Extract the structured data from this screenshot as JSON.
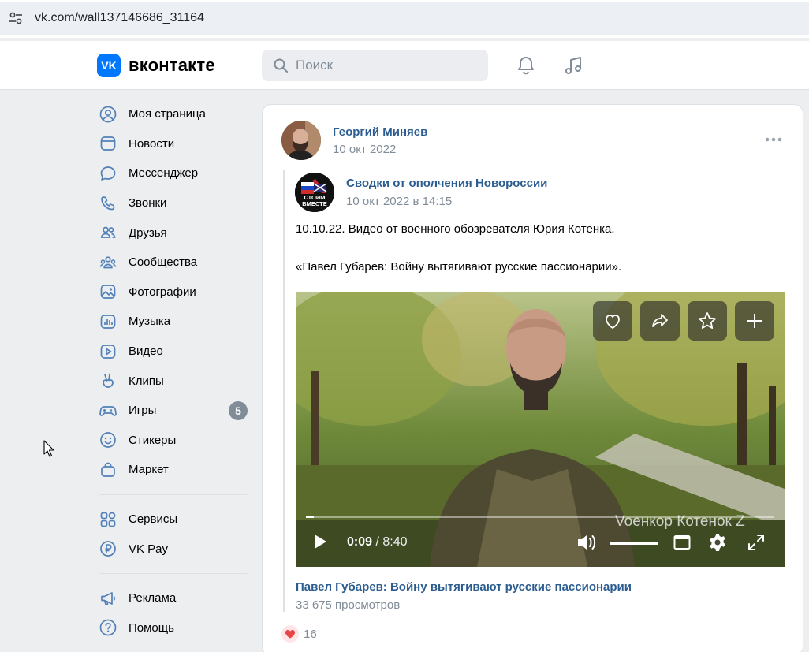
{
  "browser": {
    "url": "vk.com/wall137146686_31164"
  },
  "header": {
    "logo_mark": "VK",
    "logo_text": "вконтакте",
    "search_placeholder": "Поиск"
  },
  "nav": {
    "main": [
      {
        "label": "Моя страница",
        "icon": "user-circle-icon"
      },
      {
        "label": "Новости",
        "icon": "news-icon"
      },
      {
        "label": "Мессенджер",
        "icon": "chat-bubble-icon"
      },
      {
        "label": "Звонки",
        "icon": "phone-icon"
      },
      {
        "label": "Друзья",
        "icon": "friends-icon"
      },
      {
        "label": "Сообщества",
        "icon": "communities-icon"
      },
      {
        "label": "Фотографии",
        "icon": "photo-icon"
      },
      {
        "label": "Музыка",
        "icon": "music-bars-icon"
      },
      {
        "label": "Видео",
        "icon": "video-play-icon"
      },
      {
        "label": "Клипы",
        "icon": "clips-hand-icon"
      },
      {
        "label": "Игры",
        "icon": "gamepad-icon",
        "badge": "5"
      },
      {
        "label": "Стикеры",
        "icon": "sticker-smile-icon"
      },
      {
        "label": "Маркет",
        "icon": "market-bag-icon"
      }
    ],
    "services": [
      {
        "label": "Сервисы",
        "icon": "services-grid-icon"
      },
      {
        "label": "VK Pay",
        "icon": "vk-pay-icon"
      }
    ],
    "footer": [
      {
        "label": "Реклама",
        "icon": "megaphone-icon"
      },
      {
        "label": "Помощь",
        "icon": "help-icon"
      }
    ]
  },
  "post": {
    "author": "Георгий Миняев",
    "date": "10 окт 2022",
    "repost": {
      "author": "Сводки от ополчения Новороссии",
      "date": "10 окт 2022 в 14:15",
      "avatar_caption": "СТОИМ ВМЕСТЕ",
      "text_line1": "10.10.22. Видео от военного обозревателя Юрия Котенка.",
      "text_line2": "«Павел Губарев: Войну вытягивают русские пассионарии»."
    },
    "video": {
      "current_time": "0:09",
      "separator": " / ",
      "duration": "8:40",
      "progress": 0.017,
      "watermark": "Voенкор Котенок Z",
      "title": "Павел Губарев: Войну вытягивают русские пассионарии",
      "views": "33 675 просмотров"
    },
    "likes": "16"
  },
  "colors": {
    "accent": "#0077ff",
    "link": "#2c5d91",
    "muted": "#818c99",
    "like": "#e64646"
  }
}
